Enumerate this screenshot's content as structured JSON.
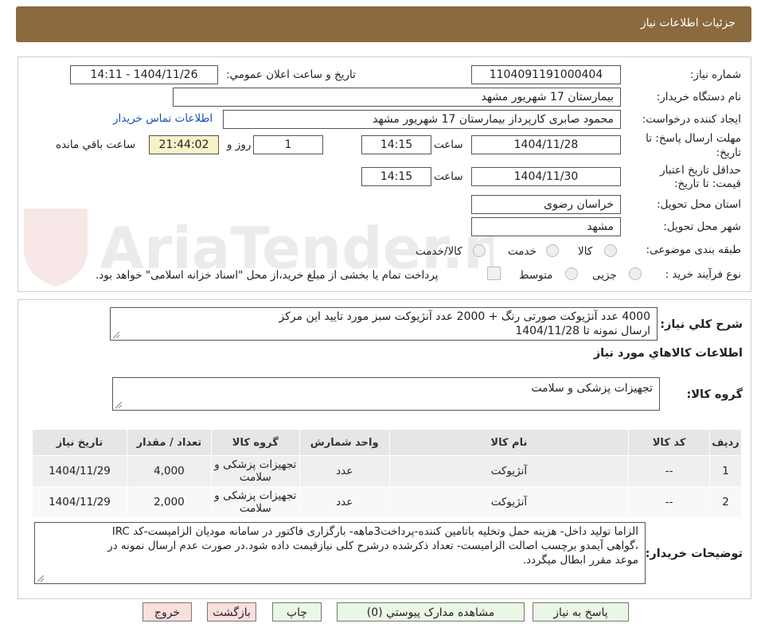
{
  "header": {
    "title": "جزئیات اطلاعات نیاز"
  },
  "watermark": {
    "text": "AriaTender.neT"
  },
  "form": {
    "need_number": {
      "label": "شماره نیاز:",
      "value": "1104091191000404"
    },
    "announce": {
      "label": "تاریخ و ساعت اعلان عمومي:",
      "value": "1404/11/26 - 14:11"
    },
    "buyer": {
      "label": "نام دستگاه خریدار:",
      "value": "بیمارستان 17 شهریور مشهد"
    },
    "creator": {
      "label": "ایجاد کننده درخواست:",
      "value": "محمود صابری کارپرداز بیمارستان 17 شهریور مشهد",
      "contact_link": "اطلاعات تماس خریدار"
    },
    "deadline": {
      "label_line1": "مهلت ارسال پاسخ: تا",
      "label_line2": "تاریخ:",
      "date": "1404/11/28",
      "time_label": "ساعت",
      "time": "14:15",
      "days": "1",
      "days_label": "روز و",
      "remaining": "21:44:02",
      "remaining_label": "ساعت باقي مانده"
    },
    "validity": {
      "label_line1": "حداقل تاریخ اعتبار",
      "label_line2": "قیمت: تا تاریخ:",
      "date": "1404/11/30",
      "time_label": "ساعت",
      "time": "14:15"
    },
    "province": {
      "label": "استان محل تحویل:",
      "value": "خراسان رضوی"
    },
    "city": {
      "label": "شهر محل تحویل:",
      "value": "مشهد"
    },
    "category": {
      "label": "طبقه بندی موضوعی:",
      "options": [
        "کالا",
        "خدمت",
        "کالا/خدمت"
      ]
    },
    "process": {
      "label": "نوع فرآیند خرید :",
      "options": [
        "جزیی",
        "متوسط"
      ],
      "note": "پرداخت تمام یا بخشی از مبلغ خرید،از محل \"اسناد خزانه اسلامی\" خواهد بود."
    }
  },
  "description": {
    "label": "شرح کلي نیاز:",
    "line1": "4000 عدد آنژیوکت صورتی رنگ + 2000 عدد آنژیوکت سبز مورد تایید این مرکز",
    "line2": "ارسال نمونه تا 1404/11/28"
  },
  "goods_section": {
    "title": "اطلاعات کالاهاي مورد نیاز"
  },
  "goods_group": {
    "label": "گروه کالا:",
    "value": "تجهیزات پزشکی و سلامت"
  },
  "table": {
    "headers": [
      "ردیف",
      "کد کالا",
      "نام کالا",
      "واحد شمارش",
      "گروه کالا",
      "تعداد / مقدار",
      "تاریخ نیاز"
    ],
    "rows": [
      {
        "index": "1",
        "code": "--",
        "name": "آنژیوکت",
        "unit": "عدد",
        "group_line1": "تجهیزات پزشکی و",
        "group_line2": "سلامت",
        "qty": "4,000",
        "date": "1404/11/29"
      },
      {
        "index": "2",
        "code": "--",
        "name": "آنژیوکت",
        "unit": "عدد",
        "group_line1": "تجهیزات پزشکی و",
        "group_line2": "سلامت",
        "qty": "2,000",
        "date": "1404/11/29"
      }
    ]
  },
  "buyer_notes": {
    "label": "توضیحات خریدار:",
    "line1": "الزاما تولید داخل- هزینه حمل وتخلیه باتامین کننده-پرداخت3ماهه- بارگزاری فاکتور در سامانه مودیان الزامیست-کد IRC",
    "line2": "،گواهی آیمدو برچسب اصالت الزامیست- تعداد ذکرشده درشرح کلی نیازقیمت داده شود.در صورت عدم ارسال نمونه در",
    "line3": "موعد مقرر ابطال میگردد."
  },
  "buttons": {
    "reply": "پاسخ به نیاز",
    "attachments": "مشاهده مدارک پیوستي (0)",
    "print": "چاپ",
    "back": "بازگشت",
    "exit": "خروج"
  },
  "colors": {
    "header_bg": "#8a6a3e",
    "green_button": "#eaf6e6",
    "red_button": "#fbdede",
    "remaining_bg": "#f6f3c8",
    "link": "#1a4fb0"
  }
}
